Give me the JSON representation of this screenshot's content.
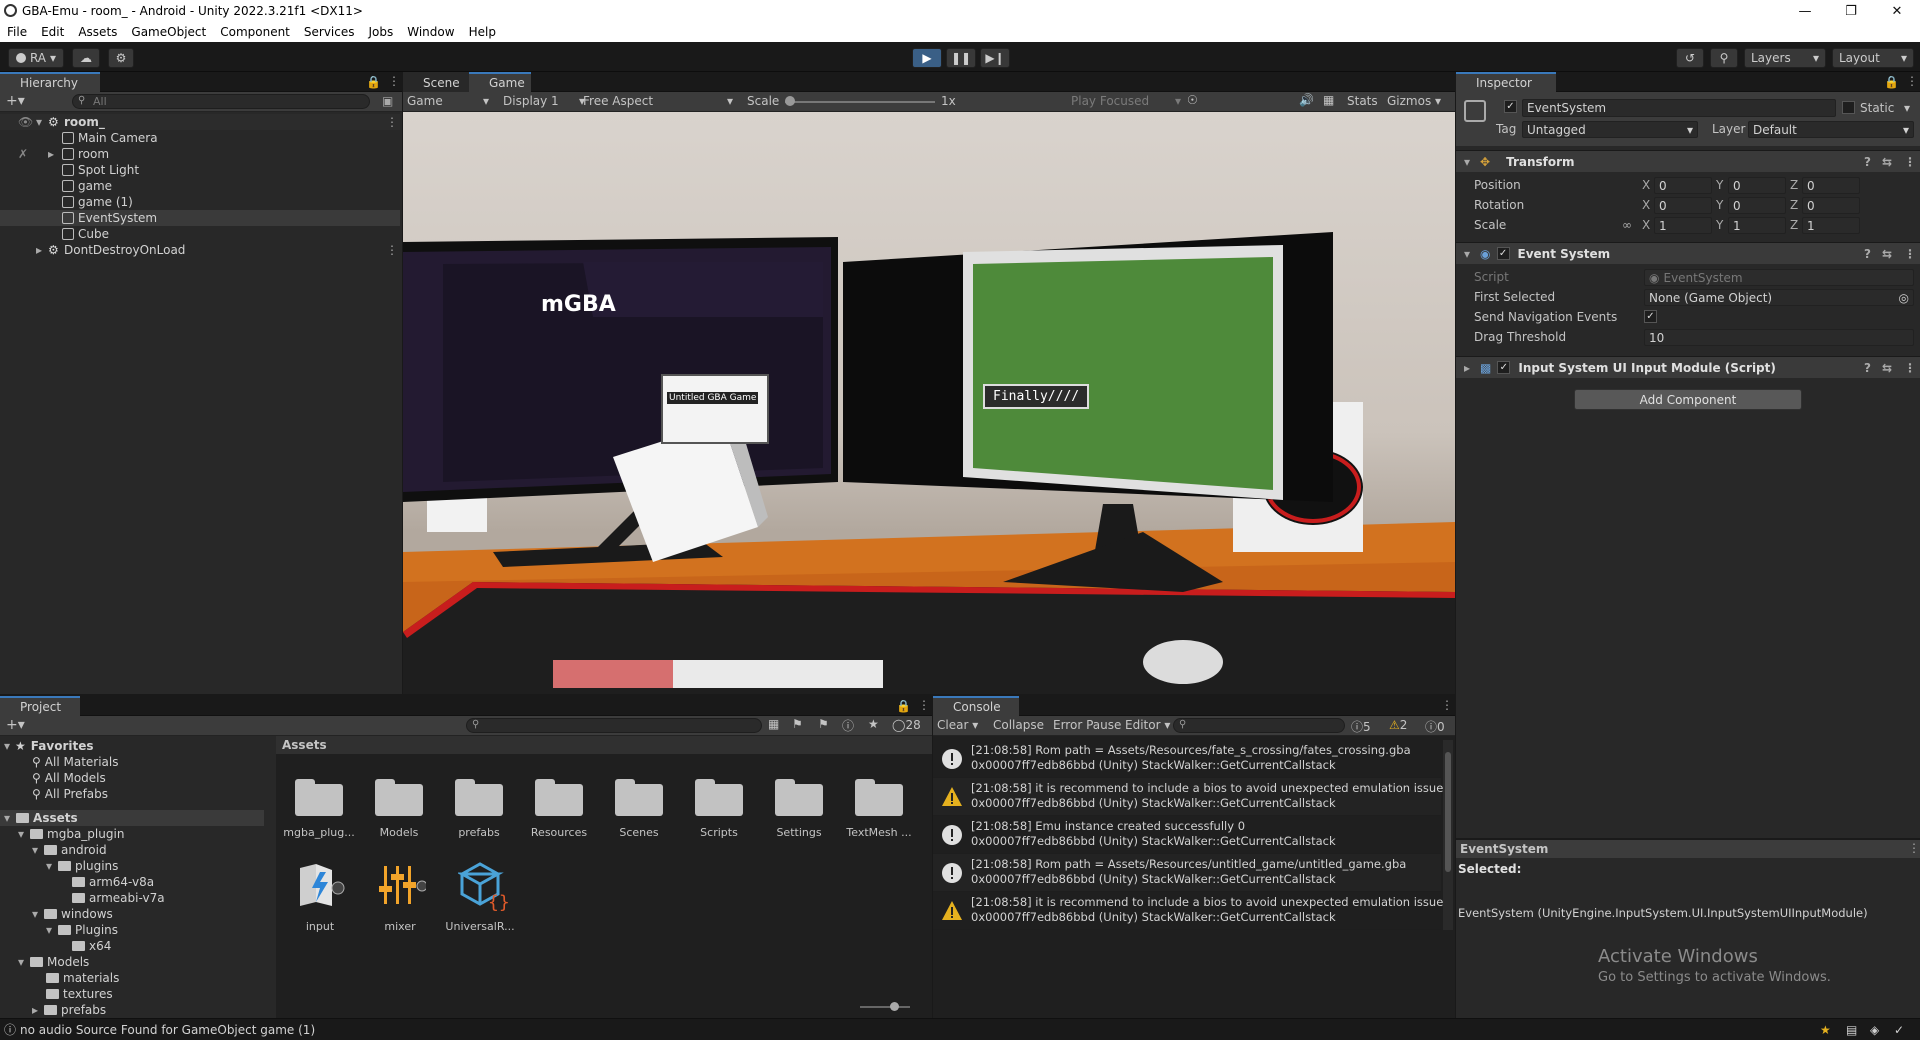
{
  "window": {
    "title": "GBA-Emu - room_ - Android - Unity 2022.3.21f1 <DX11>"
  },
  "menu": [
    "File",
    "Edit",
    "Assets",
    "GameObject",
    "Component",
    "Services",
    "Jobs",
    "Window",
    "Help"
  ],
  "toolbar": {
    "account": "RA",
    "layers": "Layers",
    "layout": "Layout"
  },
  "hierarchy": {
    "tab": "Hierarchy",
    "search_placeholder": "All",
    "scene": "room_",
    "items": [
      "Main Camera",
      "room",
      "Spot Light",
      "game",
      "game (1)",
      "EventSystem",
      "Cube"
    ],
    "dontdestroy": "DontDestroyOnLoad"
  },
  "viewport": {
    "tabs": [
      "Scene",
      "Game"
    ],
    "game_dropdown": "Game",
    "display": "Display 1",
    "aspect": "Free Aspect",
    "scale_label": "Scale",
    "scale_value": "1x",
    "play_focused": "Play Focused",
    "stats": "Stats",
    "gizmos": "Gizmos",
    "monitor_left_title": "mGBA",
    "popup_title": "Untitled GBA Game",
    "game_text": "Finally////"
  },
  "inspector": {
    "tab": "Inspector",
    "object_name": "EventSystem",
    "static_label": "Static",
    "tag_label": "Tag",
    "tag_value": "Untagged",
    "layer_label": "Layer",
    "layer_value": "Default",
    "transform": {
      "title": "Transform",
      "position_label": "Position",
      "rotation_label": "Rotation",
      "scale_label": "Scale",
      "position": [
        "0",
        "0",
        "0"
      ],
      "rotation": [
        "0",
        "0",
        "0"
      ],
      "scale": [
        "1",
        "1",
        "1"
      ],
      "axis": [
        "X",
        "Y",
        "Z"
      ]
    },
    "event_system": {
      "title": "Event System",
      "script_label": "Script",
      "script_value": "EventSystem",
      "first_selected_label": "First Selected",
      "first_selected_value": "None (Game Object)",
      "send_nav_label": "Send Navigation Events",
      "drag_label": "Drag Threshold",
      "drag_value": "10"
    },
    "input_module": "Input System UI Input Module (Script)",
    "add_component": "Add Component",
    "preview_title": "EventSystem",
    "selected_label": "Selected:",
    "selected_value": "EventSystem (UnityEngine.InputSystem.UI.InputSystemUIInputModule)",
    "watermark_title": "Activate Windows",
    "watermark_sub": "Go to Settings to activate Windows."
  },
  "project": {
    "tab": "Project",
    "count": "28",
    "favorites": "Favorites",
    "fav_items": [
      "All Materials",
      "All Models",
      "All Prefabs"
    ],
    "assets": "Assets",
    "tree": [
      "mgba_plugin",
      "android",
      "plugins",
      "arm64-v8a",
      "armeabi-v7a",
      "windows",
      "Plugins",
      "x64",
      "Models",
      "materials",
      "textures",
      "prefabs"
    ],
    "grid_header": "Assets",
    "folders": [
      "mgba_plug...",
      "Models",
      "prefabs",
      "Resources",
      "Scenes",
      "Scripts",
      "Settings",
      "TextMesh ..."
    ],
    "assets_row2": [
      "input",
      "mixer",
      "UniversalR..."
    ]
  },
  "console": {
    "tab": "Console",
    "clear": "Clear",
    "collapse": "Collapse",
    "error_pause": "Error Pause",
    "editor": "Editor",
    "info_count": "5",
    "warn_count": "2",
    "error_count": "0",
    "logs": [
      {
        "type": "info",
        "line1": "[21:08:58] Rom path = Assets/Resources/fate_s_crossing/fates_crossing.gba",
        "line2": "0x00007ff7edb86bbd (Unity) StackWalker::GetCurrentCallstack"
      },
      {
        "type": "warn",
        "line1": "[21:08:58] it is recommend to include a bios to avoid unexpected emulation issues",
        "line2": "0x00007ff7edb86bbd (Unity) StackWalker::GetCurrentCallstack"
      },
      {
        "type": "info",
        "line1": "[21:08:58] Emu instance created successfully 0",
        "line2": "0x00007ff7edb86bbd (Unity) StackWalker::GetCurrentCallstack"
      },
      {
        "type": "info",
        "line1": "[21:08:58] Rom path = Assets/Resources/untitled_game/untitled_game.gba",
        "line2": "0x00007ff7edb86bbd (Unity) StackWalker::GetCurrentCallstack"
      },
      {
        "type": "warn",
        "line1": "[21:08:58] it is recommend to include a bios to avoid unexpected emulation issues",
        "line2": "0x00007ff7edb86bbd (Unity) StackWalker::GetCurrentCallstack"
      }
    ]
  },
  "status": {
    "message": "no audio Source Found for GameObject game (1)"
  }
}
